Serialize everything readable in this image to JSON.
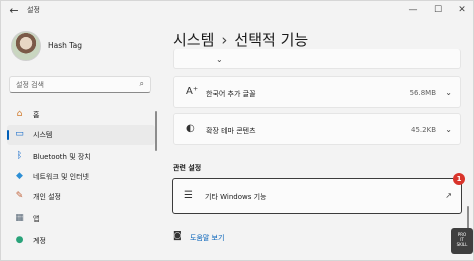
{
  "app": {
    "title": "설정"
  },
  "profile": {
    "name": "Hash Tag"
  },
  "search": {
    "placeholder": "설정 검색"
  },
  "sidebar": {
    "items": [
      {
        "label": "홈",
        "icon": "home-icon"
      },
      {
        "label": "시스템",
        "icon": "system-icon"
      },
      {
        "label": "Bluetooth 및 장치",
        "icon": "bluetooth-icon"
      },
      {
        "label": "네트워크 및 인터넷",
        "icon": "network-icon"
      },
      {
        "label": "개인 설정",
        "icon": "personalization-icon"
      },
      {
        "label": "앱",
        "icon": "apps-icon"
      },
      {
        "label": "계정",
        "icon": "accounts-icon"
      }
    ],
    "active_index": 1
  },
  "breadcrumb": {
    "parent": "시스템",
    "separator": "›",
    "current": "선택적 기능"
  },
  "features": [
    {
      "label": "한국어 추가 글꼴",
      "size": "56.8MB"
    },
    {
      "label": "확장 테마 콘텐츠",
      "size": "45.2KB"
    }
  ],
  "related": {
    "title": "관련 설정",
    "item_label": "기타 Windows 기능",
    "badge": "1"
  },
  "help": {
    "label": "도움말 보기"
  },
  "watermark": {
    "lines": [
      "PRO",
      "IT",
      "SKILL"
    ]
  },
  "colors": {
    "accent": "#005fb8",
    "badge": "#d9342b",
    "background": "#f3f3f3",
    "card": "#fbfbfb"
  }
}
